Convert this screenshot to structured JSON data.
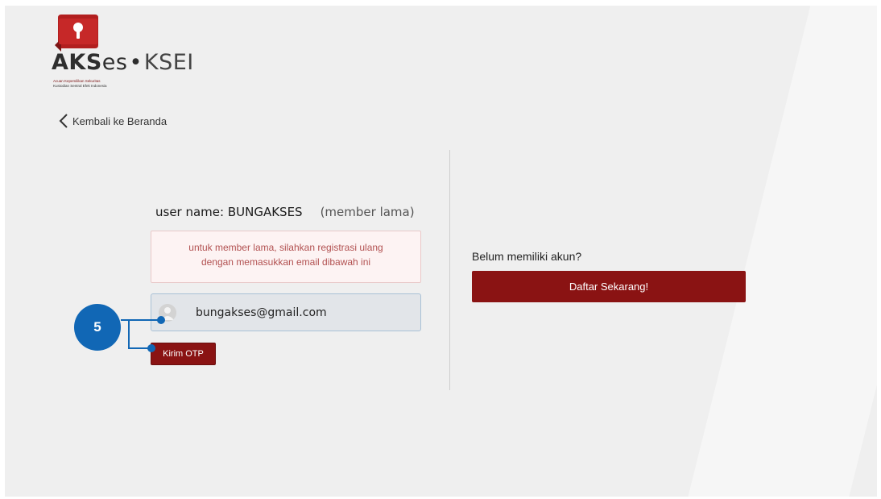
{
  "logo": {
    "wordmark_aks": "AKS",
    "wordmark_es": "es",
    "wordmark_dot": "•",
    "wordmark_ksei": "KSEI",
    "subtitle_1": "Acuan Kepemilikan Sekuritas",
    "subtitle_2": "Kustodian Sentral Efek Indonesia",
    "icon": "keyhole-shield-icon",
    "brand_color": "#b21f1f"
  },
  "back_link": {
    "label": "Kembali ke Beranda",
    "icon": "chevron-left-icon"
  },
  "form": {
    "username_label": "user name: BUNGAKSES",
    "member_tag": "(member lama)",
    "notice_line1": "untuk member lama, silahkan registrasi ulang",
    "notice_line2": "dengan memasukkan email dibawah ini",
    "email_value": "bungakses@gmail.com",
    "email_icon": "user-avatar-icon",
    "otp_button": "Kirim OTP"
  },
  "register": {
    "prompt": "Belum memiliki akun?",
    "button": "Daftar Sekarang!"
  },
  "callout": {
    "number": "5",
    "color": "#1167b5"
  },
  "colors": {
    "primary_button": "#8a1313",
    "notice_text": "#b25151",
    "notice_bg": "#fdf3f3"
  }
}
